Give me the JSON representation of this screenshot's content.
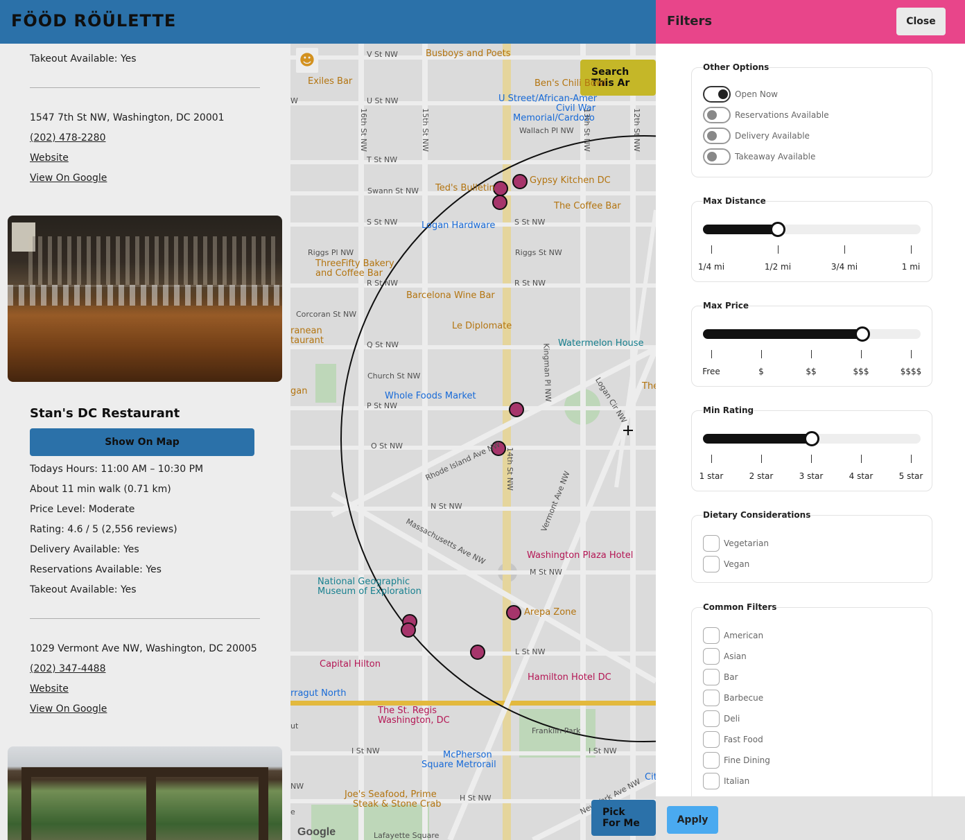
{
  "app": {
    "logo": "FÖÖD RÖÜLETTE"
  },
  "listing": {
    "prev_takeout": "Takeout Available: Yes",
    "prev_address": "1547 7th St NW, Washington, DC 20001",
    "prev_phone": "(202) 478-2280",
    "prev_website": "Website",
    "prev_google": "View On Google",
    "restaurant": {
      "name": "Stan's DC Restaurant",
      "show_on_map": "Show On Map",
      "hours": "Todays Hours: 11:00 AM – 10:30 PM",
      "walk": "About 11 min walk (0.71 km)",
      "price": "Price Level: Moderate",
      "rating": "Rating: 4.6 / 5 (2,556 reviews)",
      "delivery": "Delivery Available: Yes",
      "reservations": "Reservations Available: Yes",
      "takeout": "Takeout Available: Yes",
      "address": "1029 Vermont Ave NW, Washington, DC 20005",
      "phone": "(202) 347-4488",
      "website": "Website",
      "google": "View On Google"
    }
  },
  "map": {
    "search_btn": "Search This Ar",
    "pick_btn": "Pick For Me",
    "google": "Google",
    "pois": [
      {
        "name": "Busboys and Poets",
        "cls": "poi"
      },
      {
        "name": "Exiles Bar",
        "cls": "poi"
      },
      {
        "name": "Ben's Chili Bowl",
        "cls": "poi"
      },
      {
        "name": "U Street/African-Amer",
        "cls": "poi-blue"
      },
      {
        "name": "Civil War",
        "cls": "poi-blue"
      },
      {
        "name": "Memorial/Cardozo",
        "cls": "poi-blue"
      },
      {
        "name": "Ted's Bulletin",
        "cls": "poi"
      },
      {
        "name": "Gypsy Kitchen DC",
        "cls": "poi"
      },
      {
        "name": "The Coffee Bar",
        "cls": "poi"
      },
      {
        "name": "Logan Hardware",
        "cls": "poi-blue"
      },
      {
        "name": "ThreeFifty Bakery",
        "cls": "poi"
      },
      {
        "name": "and Coffee Bar",
        "cls": "poi"
      },
      {
        "name": "Barcelona Wine Bar",
        "cls": "poi"
      },
      {
        "name": "Le Diplomate",
        "cls": "poi"
      },
      {
        "name": "Watermelon House",
        "cls": "poi-teal"
      },
      {
        "name": "Whole Foods Market",
        "cls": "poi-blue"
      },
      {
        "name": "Washington Plaza Hotel",
        "cls": "poi-red"
      },
      {
        "name": "National Geographic",
        "cls": "poi-teal"
      },
      {
        "name": "Museum of Exploration",
        "cls": "poi-teal"
      },
      {
        "name": "Arepa Zone",
        "cls": "poi"
      },
      {
        "name": "Capital Hilton",
        "cls": "poi-red"
      },
      {
        "name": "Hamilton Hotel DC",
        "cls": "poi-red"
      },
      {
        "name": "The St. Regis",
        "cls": "poi-red"
      },
      {
        "name": "Washington, DC",
        "cls": "poi-red"
      },
      {
        "name": "Franklin Park",
        "cls": "street"
      },
      {
        "name": "McPherson",
        "cls": "poi-blue"
      },
      {
        "name": "Square Metrorail",
        "cls": "poi-blue"
      },
      {
        "name": "Joe's Seafood, Prime",
        "cls": "poi"
      },
      {
        "name": "Steak & Stone Crab",
        "cls": "poi"
      },
      {
        "name": "Lafayette Square",
        "cls": "street"
      },
      {
        "name": "ranean",
        "cls": "poi"
      },
      {
        "name": "taurant",
        "cls": "poi"
      },
      {
        "name": "gan",
        "cls": "poi"
      },
      {
        "name": "rragut North",
        "cls": "poi-blue"
      },
      {
        "name": "The",
        "cls": "poi"
      },
      {
        "name": "Cit",
        "cls": "poi-blue"
      }
    ],
    "streets": [
      "V St NW",
      "U St NW",
      "W",
      "T St NW",
      "Swann St NW",
      "S St NW",
      "S St NW",
      "Riggs Pl NW",
      "Riggs St NW",
      "R St NW",
      "R St NW",
      "Corcoran St NW",
      "Q St NW",
      "Church St NW",
      "P St NW",
      "O St NW",
      "N St NW",
      "M St NW",
      "L St NW",
      "I St NW",
      "I St NW",
      "H St NW",
      "Wallach Pl NW",
      "Rhode Island Ave NW",
      "Massachusetts Ave NW",
      "Vermont Ave NW",
      "New York Ave NW",
      "Logan Cir NW",
      "Kingman Pl NW",
      "16th St NW",
      "15th St NW",
      "14th St NW",
      "13th St NW",
      "12th St NW",
      "NW",
      "ut",
      "e"
    ]
  },
  "filters": {
    "title": "Filters",
    "close": "Close",
    "apply": "Apply",
    "other_options": {
      "legend": "Other Options",
      "items": [
        {
          "label": "Open Now",
          "on": true
        },
        {
          "label": "Reservations Available",
          "on": false
        },
        {
          "label": "Delivery Available",
          "on": false
        },
        {
          "label": "Takeaway Available",
          "on": false
        }
      ]
    },
    "max_distance": {
      "legend": "Max Distance",
      "value_fraction": 0.333,
      "ticks": [
        "1/4 mi",
        "1/2 mi",
        "3/4 mi",
        "1 mi"
      ]
    },
    "max_price": {
      "legend": "Max Price",
      "value_fraction": 0.75,
      "ticks": [
        "Free",
        "$",
        "$$",
        "$$$",
        "$$$$"
      ]
    },
    "min_rating": {
      "legend": "Min Rating",
      "value_fraction": 0.5,
      "ticks": [
        "1 star",
        "2 star",
        "3 star",
        "4 star",
        "5 star"
      ]
    },
    "dietary": {
      "legend": "Dietary Considerations",
      "items": [
        "Vegetarian",
        "Vegan"
      ]
    },
    "common": {
      "legend": "Common Filters",
      "items": [
        "American",
        "Asian",
        "Bar",
        "Barbecue",
        "Deli",
        "Fast Food",
        "Fine Dining",
        "Italian"
      ]
    }
  }
}
